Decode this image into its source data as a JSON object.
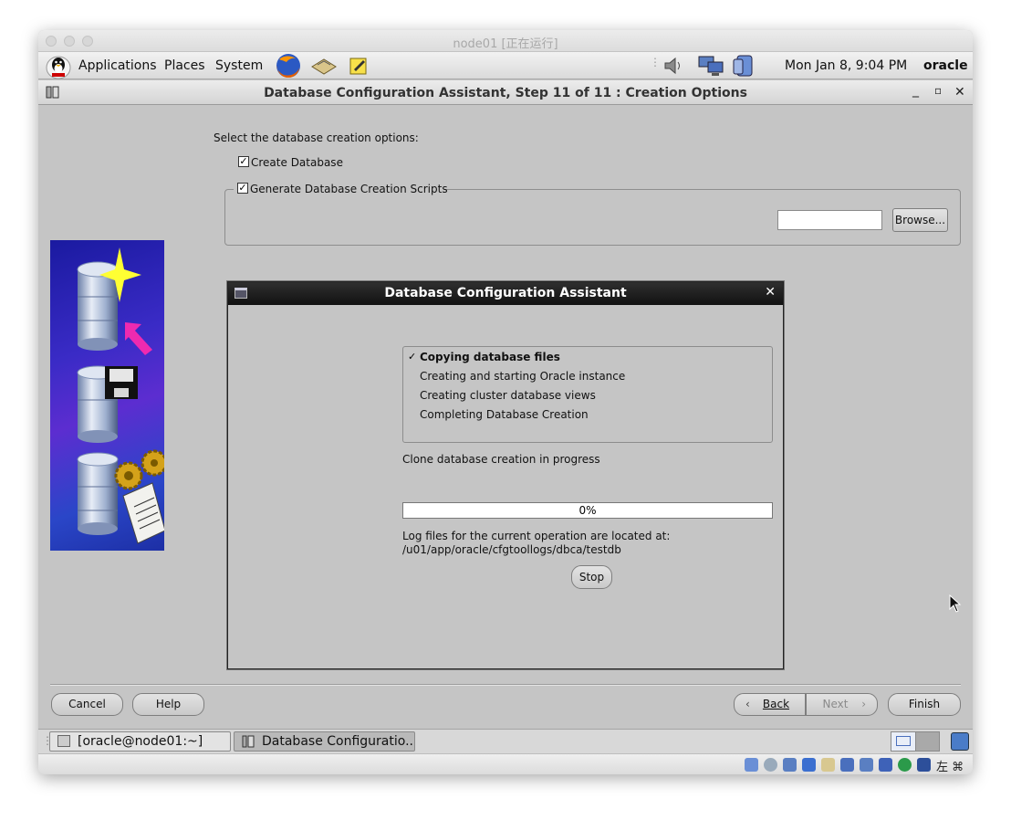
{
  "vm": {
    "title": "node01 [正在运行]"
  },
  "panel": {
    "menus": [
      "Applications",
      "Places",
      "System"
    ],
    "clock": "Mon Jan  8,  9:04 PM",
    "user": "oracle"
  },
  "window": {
    "title": "Database Configuration Assistant, Step 11 of 11 : Creation Options",
    "controls": {
      "minimize": "_",
      "maximize": "▫",
      "close": "✕"
    }
  },
  "creation_options": {
    "prompt": "Select the database creation options:",
    "create_database_label": "Create Database",
    "create_database_checked": true,
    "generate_scripts_label": "Generate Database Creation Scripts",
    "generate_scripts_checked": true,
    "browse_label": "Browse..."
  },
  "progress_dialog": {
    "title": "Database Configuration Assistant",
    "close": "✕",
    "steps": [
      {
        "label": "Copying database files",
        "done": true
      },
      {
        "label": "Creating and starting Oracle instance",
        "done": false
      },
      {
        "label": "Creating cluster database views",
        "done": false
      },
      {
        "label": "Completing Database Creation",
        "done": false
      }
    ],
    "check_mark": "✓",
    "status": "Clone database creation in progress",
    "progress_percent": 0,
    "progress_text": "0%",
    "log_label": "Log files for the current operation are located at:",
    "log_path": "/u01/app/oracle/cfgtoollogs/dbca/testdb",
    "stop_label": "Stop"
  },
  "footer": {
    "cancel_label": "Cancel",
    "help_label": "Help",
    "back_label": "Back",
    "next_label": "Next",
    "finish_label": "Finish"
  },
  "taskbar": {
    "tasks": [
      "[oracle@node01:~]",
      "Database Configuratio..."
    ]
  },
  "statusbar": {
    "ime_text": "左 ⌘"
  },
  "colors": {
    "accent": "#4a6fbd",
    "dialog_title_bg": "#1a1a1a"
  }
}
